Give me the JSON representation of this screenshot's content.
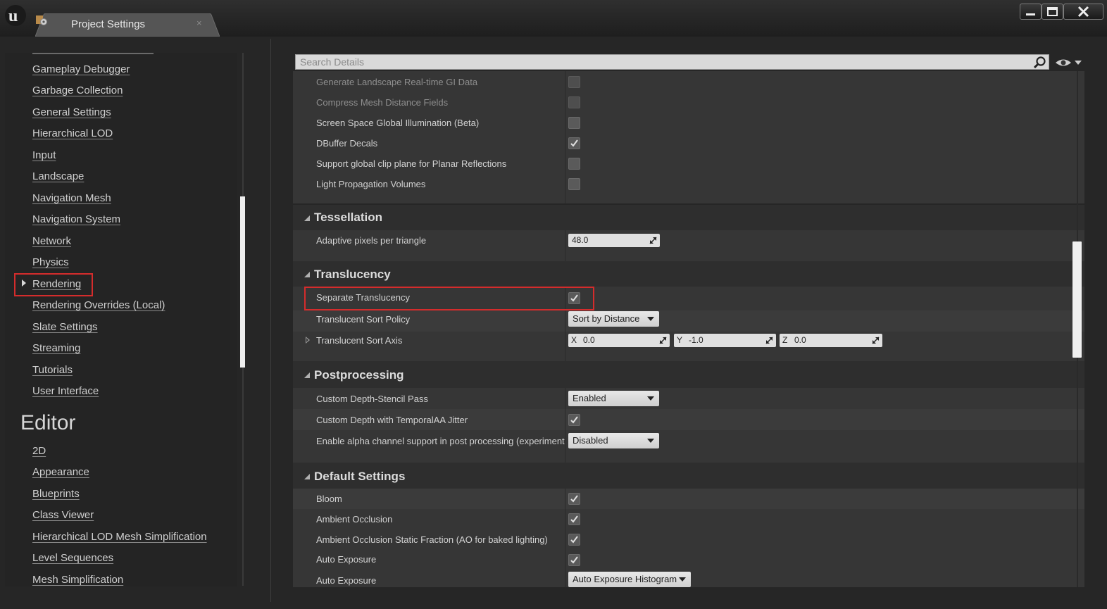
{
  "window": {
    "tab_title": "Project Settings",
    "tab_close": "×",
    "logo": "unreal-engine-logo",
    "controls": [
      "minimize-icon",
      "maximize-icon",
      "close-icon"
    ]
  },
  "sidebar": {
    "items": [
      {
        "label": "Gameplay Debugger",
        "name": "gameplay-debugger"
      },
      {
        "label": "Garbage Collection",
        "name": "garbage-collection"
      },
      {
        "label": "General Settings",
        "name": "general-settings"
      },
      {
        "label": "Hierarchical LOD",
        "name": "hierarchical-lod"
      },
      {
        "label": "Input",
        "name": "input"
      },
      {
        "label": "Landscape",
        "name": "landscape"
      },
      {
        "label": "Navigation Mesh",
        "name": "navigation-mesh"
      },
      {
        "label": "Navigation System",
        "name": "navigation-system"
      },
      {
        "label": "Network",
        "name": "network"
      },
      {
        "label": "Physics",
        "name": "physics"
      },
      {
        "label": "Rendering",
        "name": "rendering"
      },
      {
        "label": "Rendering Overrides (Local)",
        "name": "rendering-overrides-local"
      },
      {
        "label": "Slate Settings",
        "name": "slate-settings"
      },
      {
        "label": "Streaming",
        "name": "streaming"
      },
      {
        "label": "Tutorials",
        "name": "tutorials"
      },
      {
        "label": "User Interface",
        "name": "user-interface"
      }
    ],
    "editor_heading": "Editor",
    "editor_items": [
      {
        "label": "2D",
        "name": "2d"
      },
      {
        "label": "Appearance",
        "name": "appearance"
      },
      {
        "label": "Blueprints",
        "name": "blueprints"
      },
      {
        "label": "Class Viewer",
        "name": "class-viewer"
      },
      {
        "label": "Hierarchical LOD Mesh Simplification",
        "name": "hlod-mesh-simplification"
      },
      {
        "label": "Level Sequences",
        "name": "level-sequences"
      },
      {
        "label": "Mesh Simplification",
        "name": "mesh-simplification"
      }
    ],
    "selected": "Rendering"
  },
  "search": {
    "placeholder": "Search Details"
  },
  "details": {
    "top_rows": [
      {
        "label": "Generate Landscape Real-time GI Data",
        "checked": false,
        "enabled": false
      },
      {
        "label": "Compress Mesh Distance Fields",
        "checked": false,
        "enabled": false
      },
      {
        "label": "Screen Space Global Illumination (Beta)",
        "checked": false,
        "enabled": true
      },
      {
        "label": "DBuffer Decals",
        "checked": true,
        "enabled": true
      },
      {
        "label": "Support global clip plane for Planar Reflections",
        "checked": false,
        "enabled": true
      },
      {
        "label": "Light Propagation Volumes",
        "checked": false,
        "enabled": true
      }
    ],
    "tessellation": {
      "title": "Tessellation",
      "adaptive_label": "Adaptive pixels per triangle",
      "adaptive_value": "48.0"
    },
    "translucency": {
      "title": "Translucency",
      "separate_label": "Separate Translucency",
      "separate_checked": true,
      "sort_policy_label": "Translucent Sort Policy",
      "sort_policy_value": "Sort by Distance",
      "sort_axis_label": "Translucent Sort Axis",
      "axis_x_label": "X",
      "axis_x": "0.0",
      "axis_y_label": "Y",
      "axis_y": "-1.0",
      "axis_z_label": "Z",
      "axis_z": "0.0"
    },
    "postprocessing": {
      "title": "Postprocessing",
      "stencil_label": "Custom Depth-Stencil Pass",
      "stencil_value": "Enabled",
      "jitter_label": "Custom Depth with TemporalAA Jitter",
      "jitter_checked": true,
      "alpha_label": "Enable alpha channel support in post processing (experimenta",
      "alpha_value": "Disabled"
    },
    "defaults": {
      "title": "Default Settings",
      "bloom_label": "Bloom",
      "ao_label": "Ambient Occlusion",
      "ao_static_label": "Ambient Occlusion Static Fraction (AO for baked lighting)",
      "auto_exposure_label": "Auto Exposure",
      "auto_exposure2_label": "Auto Exposure",
      "auto_exposure2_value": "Auto Exposure Histogram"
    }
  }
}
